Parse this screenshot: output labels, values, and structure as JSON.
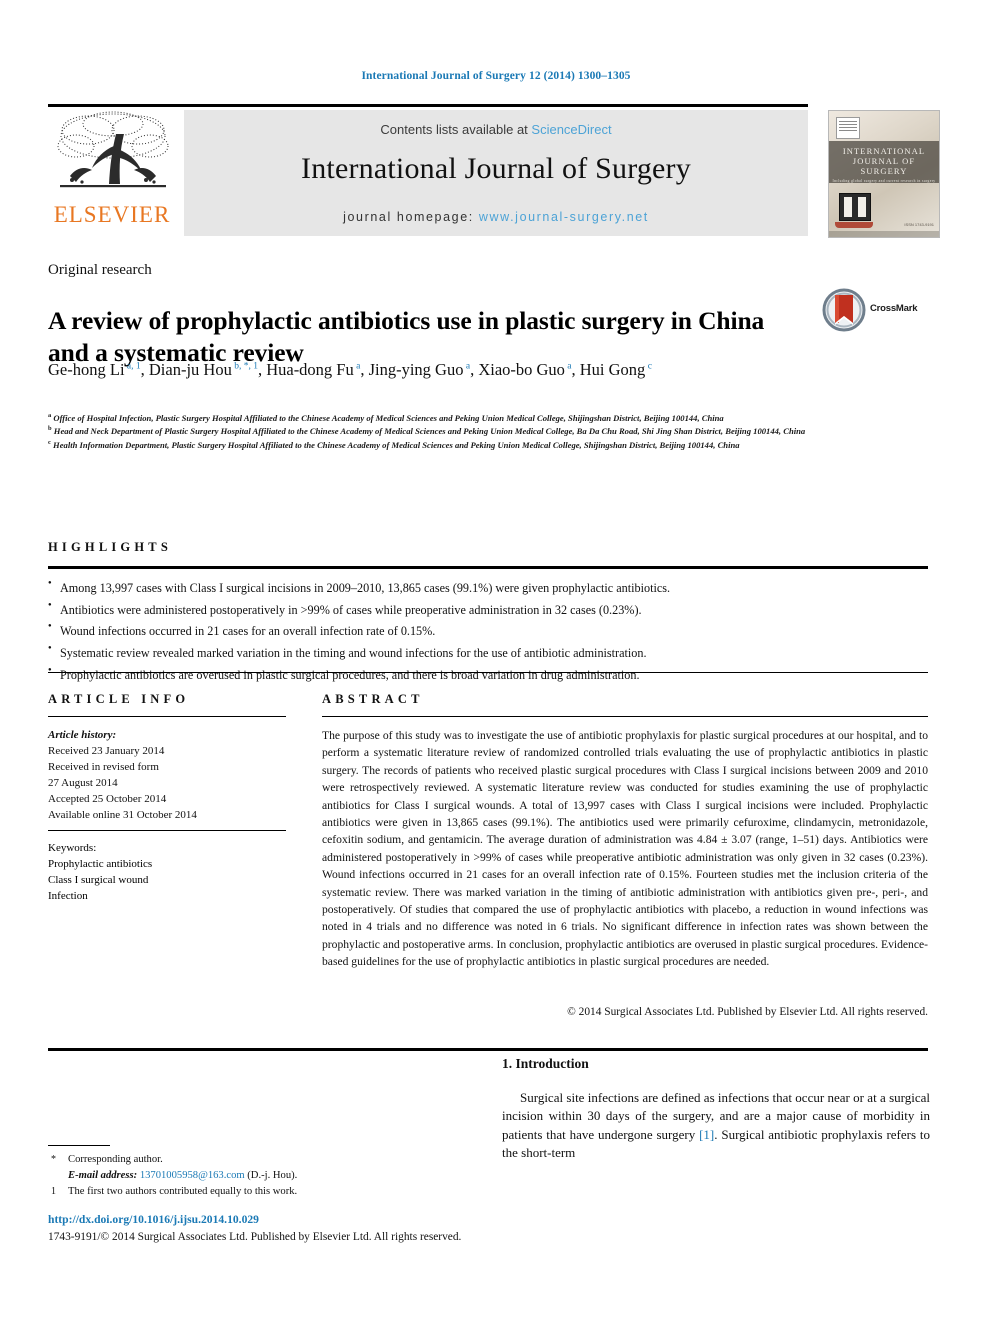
{
  "running_head": "International Journal of Surgery 12 (2014) 1300–1305",
  "masthead": {
    "publisher_logo_label": "ELSEVIER",
    "contents_prefix": "Contents lists available at ",
    "contents_link": "ScienceDirect",
    "journal_title": "International Journal of Surgery",
    "homepage_prefix": "journal homepage: ",
    "homepage_link": "www.journal-surgery.net",
    "cover": {
      "line1": "INTERNATIONAL",
      "line2": "JOURNAL OF SURGERY",
      "line3": "Including global surgery and current research in surgery",
      "corner_text": "ISSN 1743-9191"
    }
  },
  "article": {
    "type": "Original research",
    "title": "A review of prophylactic antibiotics use in plastic surgery in China and a systematic review",
    "crossmark_label": "CrossMark",
    "authors_line1": "Ge-hong Li",
    "authors": [
      {
        "name": "Ge-hong Li",
        "sup": "a, 1"
      },
      {
        "name": "Dian-ju Hou",
        "sup": "b, *, 1"
      },
      {
        "name": "Hua-dong Fu",
        "sup": "a"
      },
      {
        "name": "Jing-ying Guo",
        "sup": "a"
      },
      {
        "name": "Xiao-bo Guo",
        "sup": "a"
      },
      {
        "name": "Hui Gong",
        "sup": "c"
      }
    ],
    "affiliations": [
      {
        "mark": "a",
        "text": "Office of Hospital Infection, Plastic Surgery Hospital Affiliated to the Chinese Academy of Medical Sciences and Peking Union Medical College, Shijingshan District, Beijing 100144, China"
      },
      {
        "mark": "b",
        "text": "Head and Neck Department of Plastic Surgery Hospital Affiliated to the Chinese Academy of Medical Sciences and Peking Union Medical College, Ba Da Chu Road, Shi Jing Shan District, Beijing 100144, China"
      },
      {
        "mark": "c",
        "text": "Health Information Department, Plastic Surgery Hospital Affiliated to the Chinese Academy of Medical Sciences and Peking Union Medical College, Shijingshan District, Beijing 100144, China"
      }
    ]
  },
  "highlights": {
    "label": "HIGHLIGHTS",
    "items": [
      "Among 13,997 cases with Class I surgical incisions in 2009–2010, 13,865 cases (99.1%) were given prophylactic antibiotics.",
      "Antibiotics were administered postoperatively in >99% of cases while preoperative administration in 32 cases (0.23%).",
      "Wound infections occurred in 21 cases for an overall infection rate of 0.15%.",
      "Systematic review revealed marked variation in the timing and wound infections for the use of antibiotic administration.",
      "Prophylactic antibiotics are overused in plastic surgical procedures, and there is broad variation in drug administration."
    ]
  },
  "article_info": {
    "label": "ARTICLE INFO",
    "history_heading": "Article history:",
    "history": [
      "Received 23 January 2014",
      "Received in revised form",
      "27 August 2014",
      "Accepted 25 October 2014",
      "Available online 31 October 2014"
    ],
    "keywords_heading": "Keywords:",
    "keywords": [
      "Prophylactic antibiotics",
      "Class I surgical wound",
      "Infection"
    ]
  },
  "abstract": {
    "label": "ABSTRACT",
    "text": "The purpose of this study was to investigate the use of antibiotic prophylaxis for plastic surgical procedures at our hospital, and to perform a systematic literature review of randomized controlled trials evaluating the use of prophylactic antibiotics in plastic surgery. The records of patients who received plastic surgical procedures with Class I surgical incisions between 2009 and 2010 were retrospectively reviewed. A systematic literature review was conducted for studies examining the use of prophylactic antibiotics for Class I surgical wounds. A total of 13,997 cases with Class I surgical incisions were included. Prophylactic antibiotics were given in 13,865 cases (99.1%). The antibiotics used were primarily cefuroxime, clindamycin, metronidazole, cefoxitin sodium, and gentamicin. The average duration of administration was 4.84 ± 3.07 (range, 1–51) days. Antibiotics were administered postoperatively in >99% of cases while preoperative antibiotic administration was only given in 32 cases (0.23%). Wound infections occurred in 21 cases for an overall infection rate of 0.15%. Fourteen studies met the inclusion criteria of the systematic review. There was marked variation in the timing of antibiotic administration with antibiotics given pre-, peri-, and postoperatively. Of studies that compared the use of prophylactic antibiotics with placebo, a reduction in wound infections was noted in 4 trials and no difference was noted in 6 trials. No significant difference in infection rates was shown between the prophylactic and postoperative arms. In conclusion, prophylactic antibiotics are overused in plastic surgical procedures. Evidence-based guidelines for the use of prophylactic antibiotics in plastic surgical procedures are needed.",
    "copyright": "© 2014 Surgical Associates Ltd. Published by Elsevier Ltd. All rights reserved."
  },
  "introduction": {
    "heading": "1. Introduction",
    "paragraph_part1": "Surgical site infections are defined as infections that occur near or at a surgical incision within 30 days of the surgery, and are a major cause of morbidity in patients that have undergone surgery ",
    "reference": "[1]",
    "paragraph_part2": ". Surgical antibiotic prophylaxis refers to the short-term"
  },
  "footnotes": {
    "corresponding_mark": "*",
    "corresponding_text": "Corresponding author.",
    "email_label": "E-mail address:",
    "email": "13701005958@163.com",
    "email_suffix": " (D.-j. Hou).",
    "equal_mark": "1",
    "equal_text": "The first two authors contributed equally to this work.",
    "doi": "http://dx.doi.org/10.1016/j.ijsu.2014.10.029",
    "issn_line": "1743-9191/© 2014 Surgical Associates Ltd. Published by Elsevier Ltd. All rights reserved."
  },
  "colors": {
    "link_blue": "#1a79b5",
    "light_blue": "#4da3d6",
    "elsevier_orange": "#e87722",
    "masthead_gray": "#e6e6e6"
  }
}
